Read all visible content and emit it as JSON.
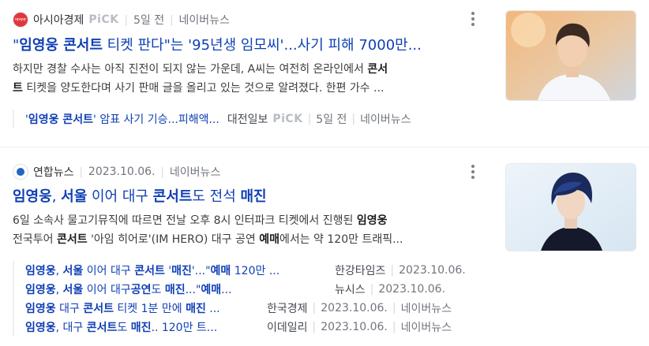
{
  "items": [
    {
      "press_name": "아시아경제",
      "logo_text": "아시아경제",
      "pick": "PiCK",
      "time": "5일 전",
      "source": "네이버뉴스",
      "title_parts": [
        "\"",
        "임영웅 콘서트",
        " 티켓 판다\"는 '95년생 임모씨'...사기 피해 7000만..."
      ],
      "desc_line1_parts": [
        "하지만 경찰 수사는 아직 진전이 되지 않는 가운데, A씨는 여전히 온라인에서 ",
        "콘서"
      ],
      "desc_line2_parts": [
        "트",
        " 티켓을 양도한다며 사기 판매 글을 올리고 있는 것으로 알려졌다. 한편 가수 ..."
      ],
      "related": [
        {
          "title_parts": [
            "'",
            "임영웅 콘서트",
            "' 암표 사기 기승...피해액..."
          ],
          "press": "대전일보",
          "pick": "PiCK",
          "time": "5일 전",
          "source": "네이버뉴스"
        }
      ]
    },
    {
      "press_name": "연합뉴스",
      "time": "2023.10.06.",
      "source": "네이버뉴스",
      "title_parts": [
        "임영웅",
        ", ",
        "서울",
        " 이어 대구 ",
        "콘서트",
        "도 전석 ",
        "매진"
      ],
      "desc_line1_parts": [
        "6일 소속사 물고기뮤직에 따르면 전날 오후 8시 인터파크 티켓에서 진행된 ",
        "임영웅"
      ],
      "desc_line2_parts": [
        "전국투어 ",
        "콘서트",
        " '아임 히어로'(IM HERO) 대구 공연 ",
        "예매",
        "에서는 약 120만 트래픽..."
      ],
      "related": [
        {
          "title_parts": [
            "임영웅",
            ", ",
            "서울",
            " 이어 대구 ",
            "콘서트",
            " '",
            "매진",
            "'...\"",
            "예매",
            " 120만 ..."
          ],
          "press": "한강타임즈",
          "time": "2023.10.06."
        },
        {
          "title_parts": [
            "임영웅",
            ", ",
            "서울",
            " 이어 대구",
            "공연",
            "도 ",
            "매진",
            "...\"",
            "예매",
            "..."
          ],
          "press": "뉴시스",
          "time": "2023.10.06."
        },
        {
          "title_parts": [
            "임영웅",
            " 대구 ",
            "콘서트",
            " 티켓 1분 만에 ",
            "매진",
            " ..."
          ],
          "press": "한국경제",
          "time": "2023.10.06.",
          "source": "네이버뉴스"
        },
        {
          "title_parts": [
            "임영웅",
            ", 대구 ",
            "콘서트",
            "도 ",
            "매진",
            ".. 120만 트..."
          ],
          "press": "이데일리",
          "time": "2023.10.06.",
          "source": "네이버뉴스"
        }
      ]
    }
  ],
  "colors": {
    "title_blue": "#0f3fb5",
    "logo_red": "#e2363d",
    "pick_gray": "#b7bcc4"
  },
  "icons": {
    "more": "more-vertical-icon"
  }
}
